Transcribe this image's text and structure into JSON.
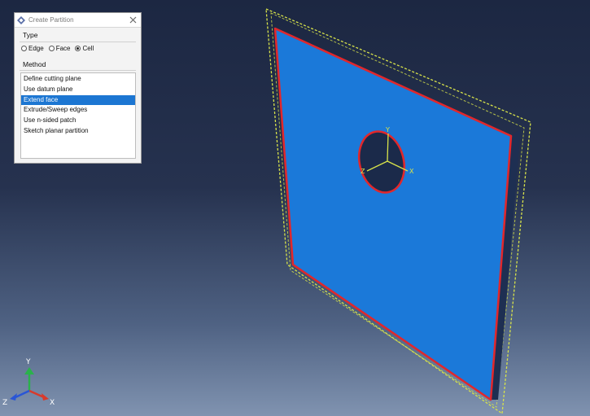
{
  "dialog": {
    "title": "Create Partition",
    "type_group_label": "Type",
    "type_options": [
      {
        "label": "Edge",
        "selected": false
      },
      {
        "label": "Face",
        "selected": false
      },
      {
        "label": "Cell",
        "selected": true
      }
    ],
    "method_group_label": "Method",
    "methods": [
      {
        "label": "Define cutting plane",
        "selected": false
      },
      {
        "label": "Use datum plane",
        "selected": false
      },
      {
        "label": "Extend face",
        "selected": true
      },
      {
        "label": "Extrude/Sweep edges",
        "selected": false
      },
      {
        "label": "Use n-sided patch",
        "selected": false
      },
      {
        "label": "Sketch planar partition",
        "selected": false
      }
    ],
    "icons": {
      "app": "abaqus-icon",
      "close": "close-icon"
    }
  },
  "viewport": {
    "hole_csys_labels": {
      "y": "Y",
      "x": "X",
      "z": "Z"
    },
    "triad_labels": {
      "y": "Y",
      "x": "X",
      "z": "Z"
    },
    "colors": {
      "face": "#1b79d9",
      "edge_highlight": "#e2272b",
      "bounding_box": "#d8e34a",
      "triad_y": "#2ab24b",
      "triad_x": "#d93a2b",
      "triad_z": "#2a56d6"
    }
  }
}
